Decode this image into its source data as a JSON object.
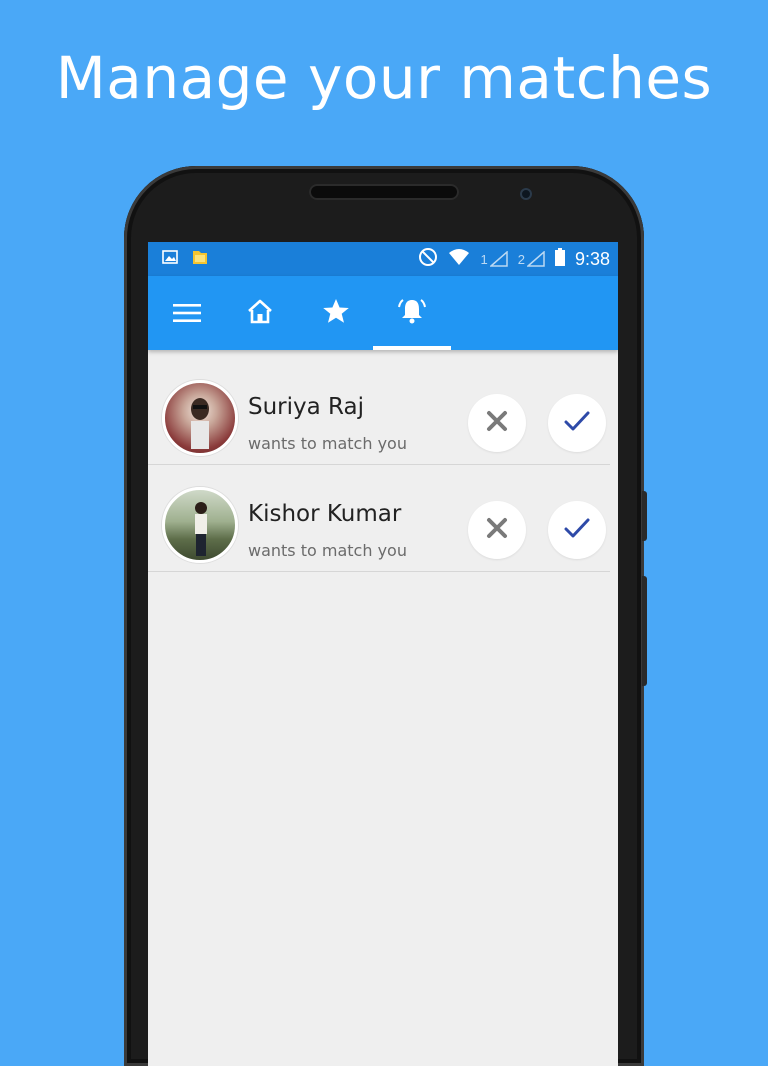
{
  "headline": "Manage your matches",
  "status_bar": {
    "time": "9:38",
    "sim1": "1",
    "sim2": "2",
    "icons": [
      "gallery-icon",
      "file-icon",
      "do-not-disturb-icon",
      "wifi-icon",
      "signal-icon",
      "battery-icon"
    ]
  },
  "tabs": [
    {
      "name": "menu",
      "icon": "hamburger-menu-icon"
    },
    {
      "name": "home",
      "icon": "home-icon"
    },
    {
      "name": "favorites",
      "icon": "star-icon"
    },
    {
      "name": "notifications",
      "icon": "bell-icon",
      "selected": true
    }
  ],
  "matches": [
    {
      "name": "Suriya Raj",
      "subtitle": "wants to match you"
    },
    {
      "name": "Kishor Kumar",
      "subtitle": "wants to match you"
    }
  ],
  "colors": {
    "background": "#4aa8f7",
    "toolbar": "#2196f3",
    "status_bar": "#1a7fd9",
    "accept": "#2e4aa8",
    "reject": "#7a7a7a"
  }
}
